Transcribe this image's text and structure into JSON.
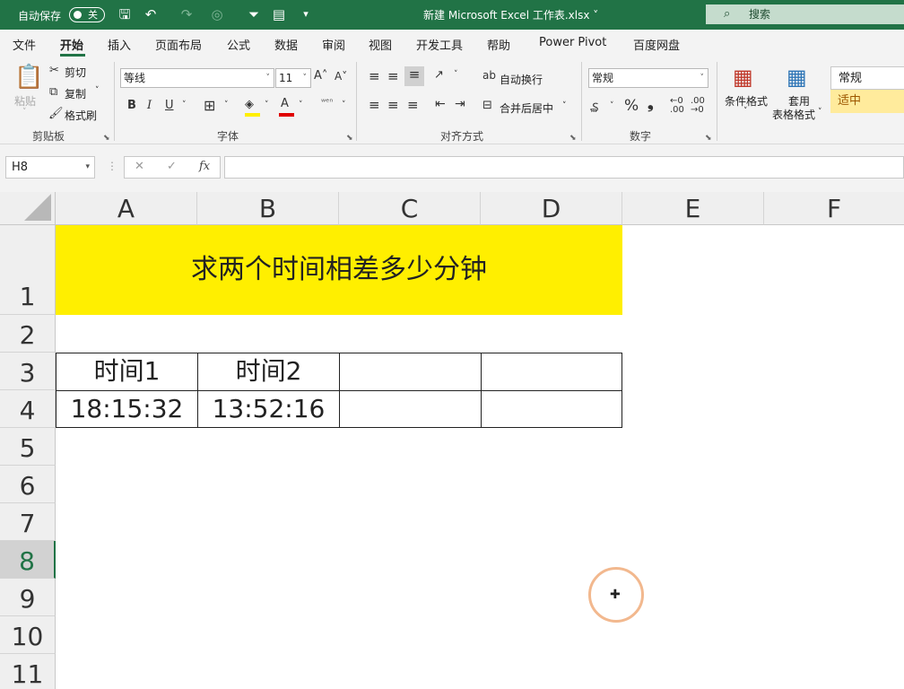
{
  "titlebar": {
    "autosave_label": "自动保存",
    "autosave_state": "关",
    "file_title": "新建 Microsoft Excel 工作表.xlsx ˅",
    "search_placeholder": "搜索"
  },
  "menu": {
    "items": [
      "文件",
      "开始",
      "插入",
      "页面布局",
      "公式",
      "数据",
      "审阅",
      "视图",
      "开发工具",
      "帮助",
      "Power Pivot",
      "百度网盘"
    ],
    "active": "开始"
  },
  "ribbon": {
    "clipboard": {
      "paste": "粘贴",
      "cut": "剪切",
      "copy": "复制",
      "format_painter": "格式刷",
      "label": "剪贴板"
    },
    "font": {
      "name": "等线",
      "size": "11",
      "label": "字体",
      "bold": "B",
      "italic": "I",
      "underline": "U"
    },
    "alignment": {
      "wrap": "自动换行",
      "merge": "合并后居中",
      "label": "对齐方式"
    },
    "number": {
      "format": "常规",
      "percent": "%",
      "comma": "❟",
      "label": "数字"
    },
    "styles": {
      "conditional": "条件格式",
      "table_format_1": "套用",
      "table_format_2": "表格格式",
      "style_normal": "常规",
      "style_neutral": "适中"
    }
  },
  "formula_bar": {
    "name_box": "H8",
    "cancel": "✕",
    "enter": "✓",
    "fx": "fx",
    "value": ""
  },
  "sheet": {
    "columns": [
      "A",
      "B",
      "C",
      "D",
      "E",
      "F"
    ],
    "rows": [
      "1",
      "2",
      "3",
      "4",
      "5",
      "6",
      "7",
      "8",
      "9",
      "10",
      "11"
    ],
    "selected_row": "8",
    "title": "求两个时间相差多少分钟",
    "header_time1": "时间1",
    "header_time2": "时间2",
    "value_time1": "18:15:32",
    "value_time2": "13:52:16"
  },
  "colors": {
    "excel_green": "#217346",
    "title_fill": "#ffef00",
    "neutral_style": "#ffeb9c"
  }
}
